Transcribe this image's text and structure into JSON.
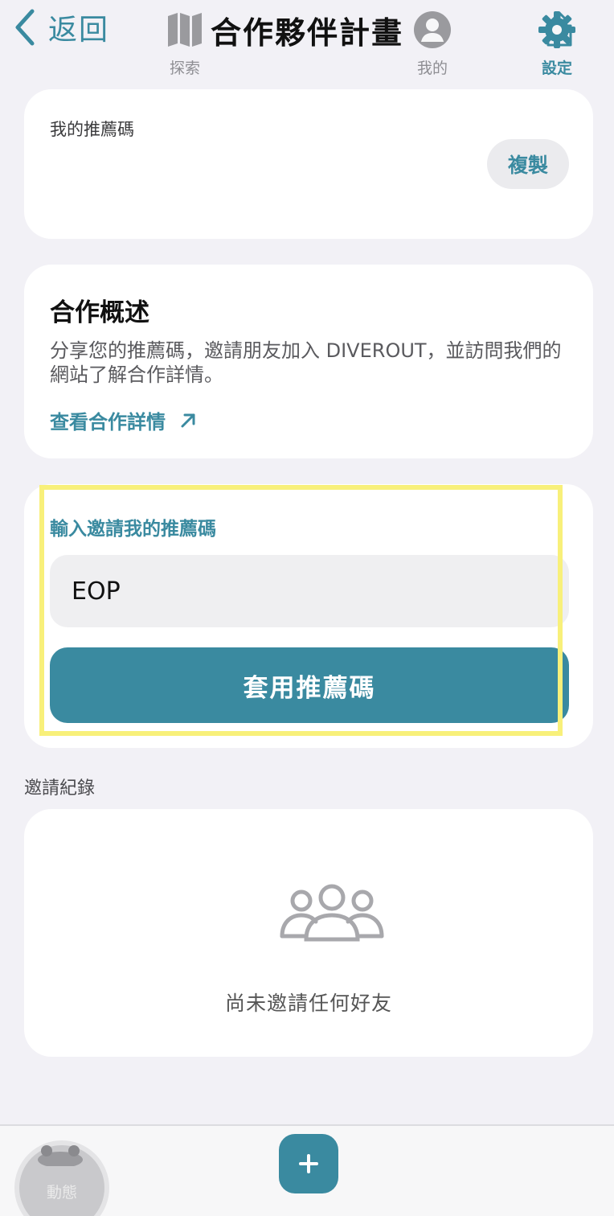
{
  "header": {
    "back_label": "返回",
    "title": "合作夥伴計畫"
  },
  "referral": {
    "label": "我的推薦碼",
    "copy_label": "複製"
  },
  "overview": {
    "title": "合作概述",
    "description": "分享您的推薦碼，邀請朋友加入 DIVEROUT，並訪問我們的網站了解合作詳情。",
    "link_label": "查看合作詳情"
  },
  "invite": {
    "label": "輸入邀請我的推薦碼",
    "input_value": "EOP",
    "apply_label": "套用推薦碼"
  },
  "records": {
    "section_label": "邀請紀錄",
    "empty_text": "尚未邀請任何好友"
  },
  "tabbar": {
    "items": [
      {
        "label": "動態",
        "icon": "feed-avatar-icon"
      },
      {
        "label": "探索",
        "icon": "map-icon"
      },
      {
        "label": "",
        "icon": "plus-icon"
      },
      {
        "label": "我的",
        "icon": "person-icon"
      },
      {
        "label": "設定",
        "icon": "gear-icon"
      }
    ],
    "active": "設定"
  },
  "colors": {
    "accent": "#3a8aa0",
    "background": "#f2f1f6",
    "card": "#ffffff",
    "highlight": "#f8f07a"
  }
}
